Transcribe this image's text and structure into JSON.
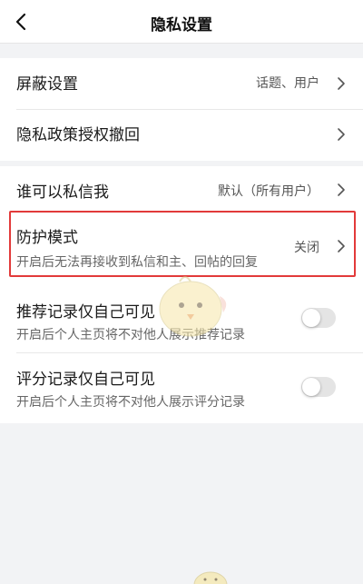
{
  "header": {
    "title": "隐私设置",
    "back_icon": "chevron-left-icon"
  },
  "group1": {
    "block": {
      "label": "屏蔽设置",
      "value": "话题、用户"
    },
    "revoke": {
      "label": "隐私政策授权撤回"
    }
  },
  "group2": {
    "dm": {
      "label": "谁可以私信我",
      "value": "默认（所有用户）"
    },
    "protect": {
      "label": "防护模式",
      "desc": "开启后无法再接收到私信和主、回帖的回复",
      "value": "关闭"
    },
    "recommend": {
      "label": "推荐记录仅自己可见",
      "desc": "开启后个人主页将不对他人展示推荐记录",
      "enabled": false
    },
    "rating": {
      "label": "评分记录仅自己可见",
      "desc": "开启后个人主页将不对他人展示评分记录",
      "enabled": false
    }
  },
  "colors": {
    "highlight_border": "#e23a3a",
    "background": "#f2f3f5"
  }
}
